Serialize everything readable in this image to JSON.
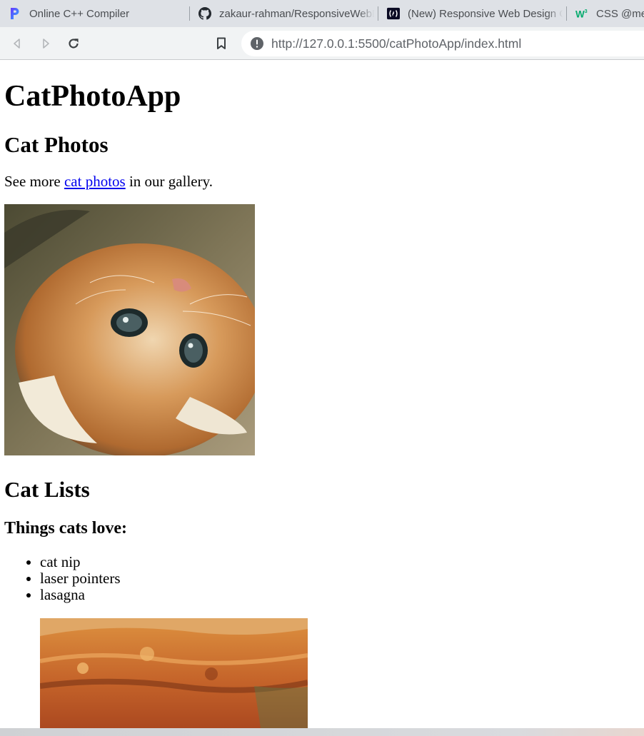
{
  "browser": {
    "tabs": [
      {
        "title": "Online C++ Compiler",
        "icon": "programiz-icon"
      },
      {
        "title": "zakaur-rahman/ResponsiveWebDesign",
        "icon": "github-icon"
      },
      {
        "title": "(New) Responsive Web Design Certification",
        "icon": "freecodecamp-icon"
      },
      {
        "title": "CSS @media Rule",
        "icon": "w3schools-icon"
      }
    ],
    "toolbar": {
      "back_icon": "back-arrow-icon",
      "forward_icon": "forward-arrow-icon",
      "reload_icon": "reload-icon",
      "bookmark_icon": "bookmark-icon"
    },
    "address": {
      "url": "http://127.0.0.1:5500/catPhotoApp/index.html",
      "security_icon": "info-icon"
    }
  },
  "page": {
    "title": "CatPhotoApp",
    "section1_heading": "Cat Photos",
    "intro_before": "See more ",
    "intro_link": "cat photos",
    "intro_after": " in our gallery.",
    "cat_image_alt": "A cute orange cat lying on its back.",
    "section2_heading": "Cat Lists",
    "list_heading": "Things cats love:",
    "list_items": [
      "cat nip",
      "laser pointers",
      "lasagna"
    ],
    "lasagna_image_alt": "A slice of lasagna on a plate."
  },
  "colors": {
    "tabstrip_bg": "#dee1e6",
    "toolbar_bg": "#f1f3f4",
    "link": "#0000ee"
  }
}
